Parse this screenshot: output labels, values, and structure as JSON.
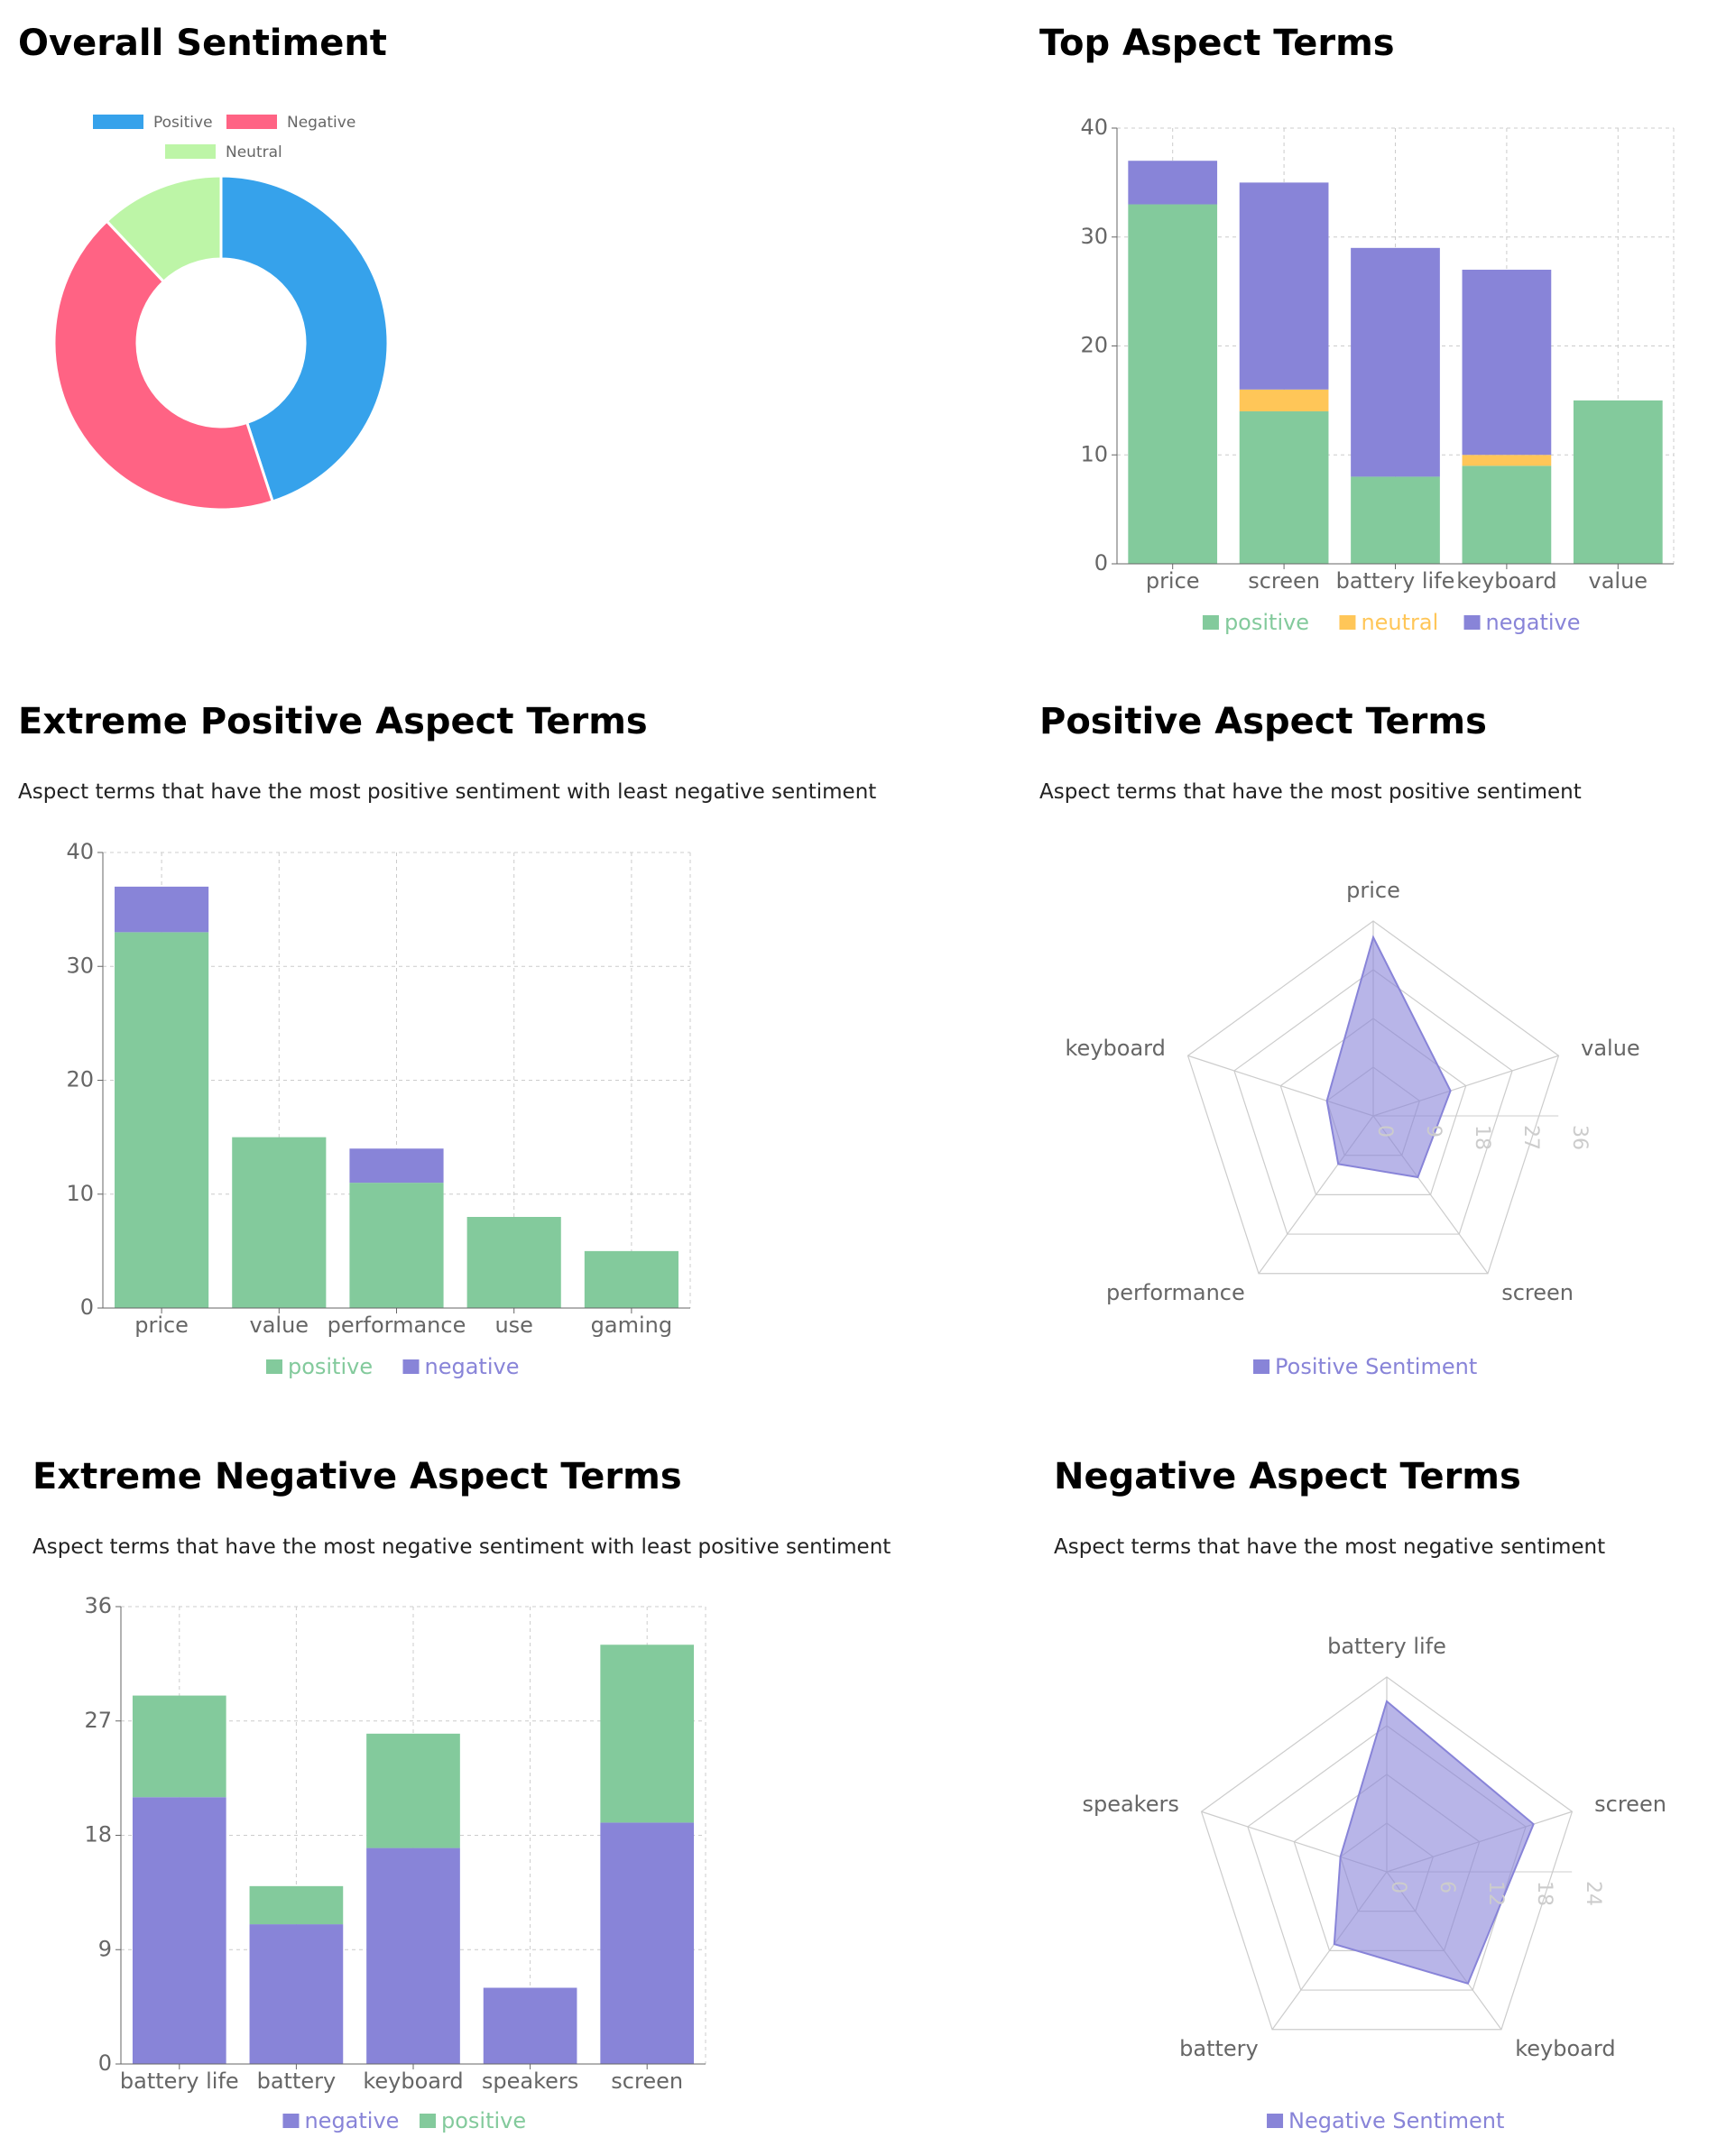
{
  "colors": {
    "positive": "#83ca9c",
    "neutral": "#ffc658",
    "negative": "#8884d8",
    "donut_positive": "#36a2eb",
    "donut_negative": "#ff6384",
    "donut_neutral": "#bdf5a7",
    "grid": "#cccccc",
    "axis": "#666666"
  },
  "panels": {
    "overall": {
      "title": "Overall Sentiment"
    },
    "top": {
      "title": "Top Aspect Terms"
    },
    "extreme_pos": {
      "title": "Extreme Positive Aspect Terms",
      "subtitle": "Aspect terms that have the most positive sentiment with least negative sentiment"
    },
    "pos": {
      "title": "Positive Aspect Terms",
      "subtitle": "Aspect terms that have the most positive sentiment"
    },
    "extreme_neg": {
      "title": "Extreme Negative Aspect Terms",
      "subtitle": "Aspect terms that have the most negative sentiment with least positive sentiment"
    },
    "neg": {
      "title": "Negative Aspect Terms",
      "subtitle": "Aspect terms that have the most negative sentiment"
    }
  },
  "chart_data": [
    {
      "id": "overall",
      "type": "pie",
      "labels": [
        "Positive",
        "Negative",
        "Neutral"
      ],
      "values": [
        45,
        43,
        12
      ],
      "legend": "top"
    },
    {
      "id": "top",
      "type": "bar",
      "stacked": true,
      "categories": [
        "price",
        "screen",
        "battery life",
        "keyboard",
        "value"
      ],
      "series": [
        {
          "name": "positive",
          "values": [
            33,
            14,
            8,
            9,
            15
          ]
        },
        {
          "name": "neutral",
          "values": [
            0,
            2,
            0,
            1,
            0
          ]
        },
        {
          "name": "negative",
          "values": [
            4,
            19,
            21,
            17,
            0
          ]
        }
      ],
      "ylim": [
        0,
        40
      ],
      "yticks": [
        0,
        10,
        20,
        30,
        40
      ],
      "grid": true,
      "legend": "bottom"
    },
    {
      "id": "extreme_pos",
      "type": "bar",
      "stacked": true,
      "categories": [
        "price",
        "value",
        "performance",
        "use",
        "gaming"
      ],
      "series": [
        {
          "name": "positive",
          "values": [
            33,
            15,
            11,
            8,
            5
          ]
        },
        {
          "name": "negative",
          "values": [
            4,
            0,
            3,
            0,
            0
          ]
        }
      ],
      "ylim": [
        0,
        40
      ],
      "yticks": [
        0,
        10,
        20,
        30,
        40
      ],
      "grid": true,
      "legend": "bottom"
    },
    {
      "id": "pos",
      "type": "radar",
      "axes": [
        "price",
        "value",
        "screen",
        "performance",
        "keyboard"
      ],
      "series": [
        {
          "name": "Positive Sentiment",
          "values": [
            33,
            15,
            14,
            11,
            9
          ]
        }
      ],
      "rlim": [
        0,
        36
      ],
      "rticks": [
        0,
        9,
        18,
        27,
        36
      ],
      "legend": "bottom"
    },
    {
      "id": "extreme_neg",
      "type": "bar",
      "stacked": true,
      "categories": [
        "battery life",
        "battery",
        "keyboard",
        "speakers",
        "screen"
      ],
      "series": [
        {
          "name": "negative",
          "values": [
            21,
            11,
            17,
            6,
            19
          ]
        },
        {
          "name": "positive",
          "values": [
            8,
            3,
            9,
            0,
            14
          ]
        }
      ],
      "ylim": [
        0,
        36
      ],
      "yticks": [
        0,
        9,
        18,
        27,
        36
      ],
      "grid": true,
      "legend": "bottom"
    },
    {
      "id": "neg",
      "type": "radar",
      "axes": [
        "battery life",
        "screen",
        "keyboard",
        "battery",
        "speakers"
      ],
      "series": [
        {
          "name": "Negative Sentiment",
          "values": [
            21,
            19,
            17,
            11,
            6
          ]
        }
      ],
      "rlim": [
        0,
        24
      ],
      "rticks": [
        0,
        6,
        12,
        18,
        24
      ],
      "legend": "bottom"
    }
  ]
}
